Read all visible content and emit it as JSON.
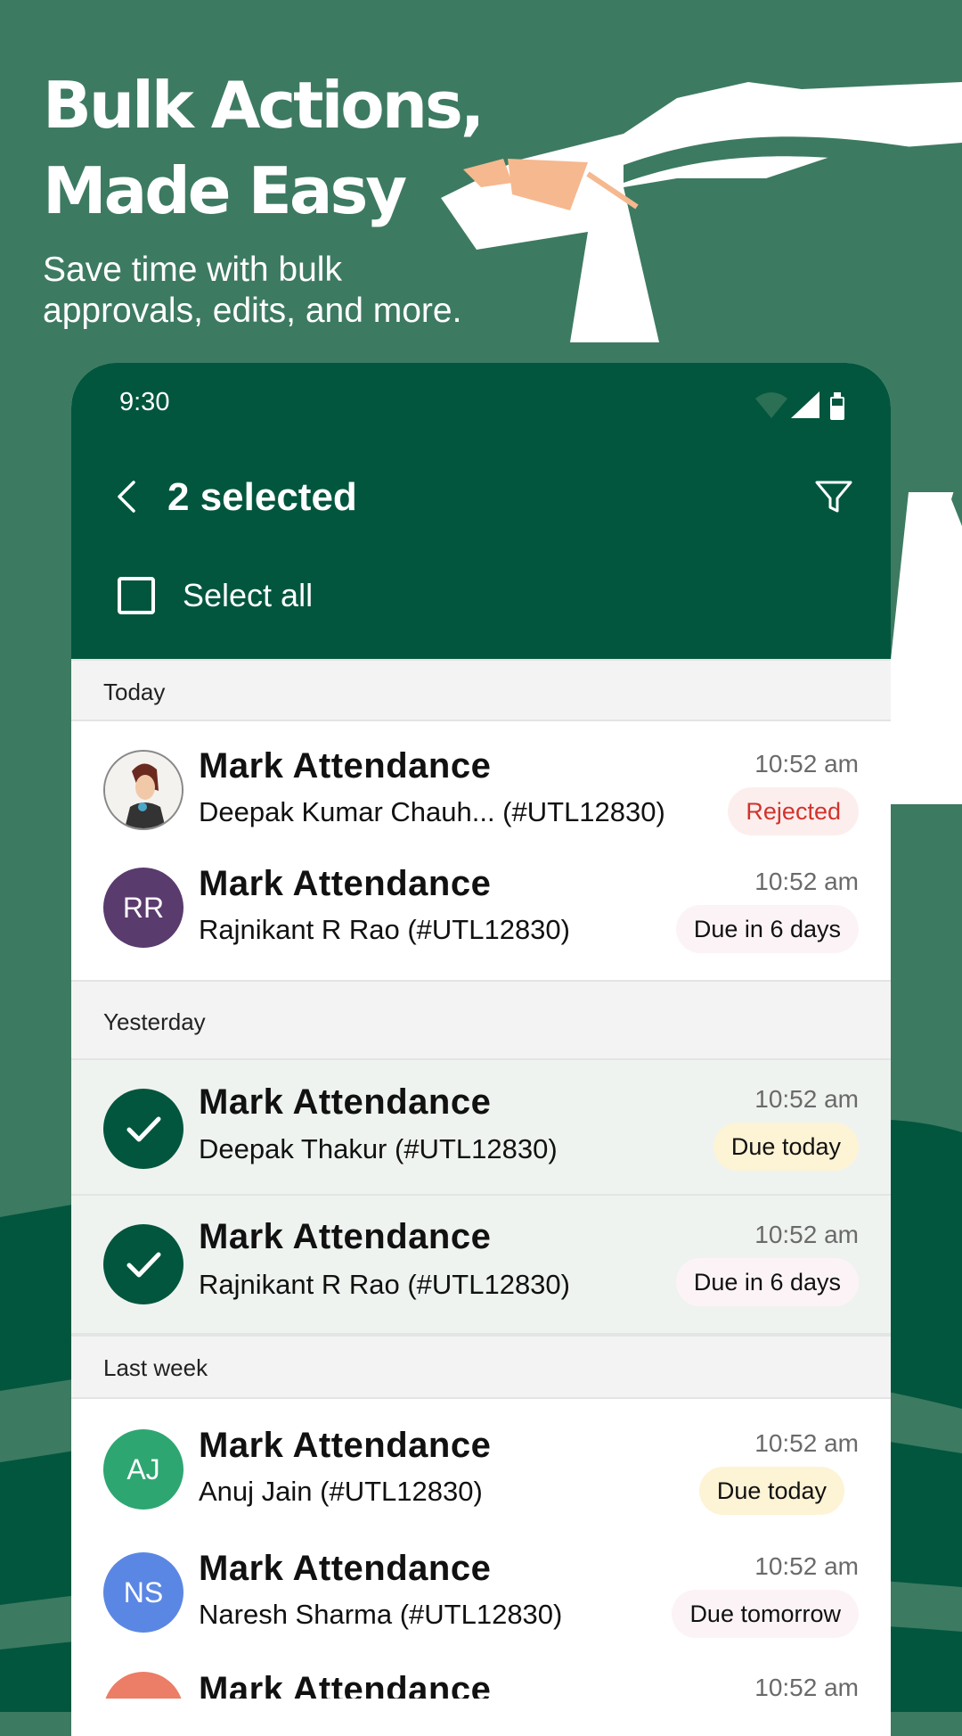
{
  "hero": {
    "title_line1": "Bulk Actions,",
    "title_line2": "Made Easy",
    "subtitle_line1": "Save time with bulk",
    "subtitle_line2": "approvals, edits, and more."
  },
  "status_bar": {
    "time": "9:30"
  },
  "app_bar": {
    "title": "2 selected",
    "select_all": "Select all"
  },
  "colors": {
    "primary": "#03563e",
    "background": "#3d7a62",
    "rejected": "#d0342c"
  },
  "sections": [
    {
      "label": "Today",
      "items": [
        {
          "title": "Mark Attendance",
          "subtitle": "Deepak Kumar Chauh... (#UTL12830)",
          "time": "10:52 am",
          "status": "Rejected",
          "avatar": "photo",
          "selected": false
        },
        {
          "title": "Mark Attendance",
          "subtitle": "Rajnikant R Rao (#UTL12830)",
          "time": "10:52 am",
          "status": "Due in 6 days",
          "avatar": "RR",
          "avatar_color": "#5a3b6e",
          "selected": false
        }
      ]
    },
    {
      "label": "Yesterday",
      "items": [
        {
          "title": "Mark Attendance",
          "subtitle": "Deepak Thakur (#UTL12830)",
          "time": "10:52 am",
          "status": "Due today",
          "avatar": "check",
          "selected": true
        },
        {
          "title": "Mark Attendance",
          "subtitle": "Rajnikant R Rao (#UTL12830)",
          "time": "10:52 am",
          "status": "Due in 6 days",
          "avatar": "check",
          "selected": true
        }
      ]
    },
    {
      "label": "Last week",
      "items": [
        {
          "title": "Mark Attendance",
          "subtitle": "Anuj Jain (#UTL12830)",
          "time": "10:52 am",
          "status": "Due today",
          "avatar": "AJ",
          "avatar_color": "#2ea672",
          "selected": false
        },
        {
          "title": "Mark Attendance",
          "subtitle": "Naresh Sharma (#UTL12830)",
          "time": "10:52 am",
          "status": "Due tomorrow",
          "avatar": "NS",
          "avatar_color": "#5b87e4",
          "selected": false
        },
        {
          "title": "Mark Attendance",
          "subtitle": "",
          "time": "10:52 am",
          "status": "",
          "avatar": "",
          "avatar_color": "#ec7d66",
          "selected": false
        }
      ]
    }
  ]
}
